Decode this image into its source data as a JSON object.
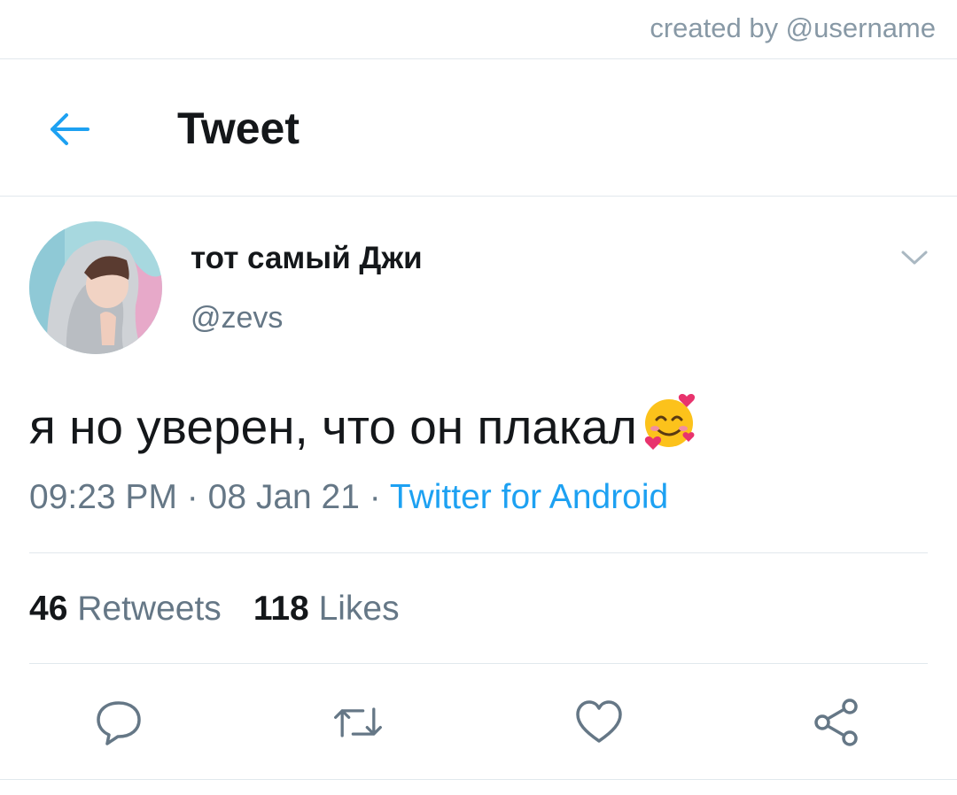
{
  "watermark": "created by @username",
  "header": {
    "title": "Tweet",
    "back_icon": "arrow-left-icon"
  },
  "tweet": {
    "display_name": "тот самый Джи",
    "handle": "@zevs",
    "text": "я но уверен, что он плакал",
    "emoji": "smiling-face-with-hearts",
    "time": "09:23 PM",
    "sep1": "·",
    "date": "08 Jan 21",
    "sep2": "·",
    "source": "Twitter for Android"
  },
  "stats": {
    "retweets_count": "46",
    "retweets_label": "Retweets",
    "likes_count": "118",
    "likes_label": "Likes"
  },
  "actions": [
    "reply-icon",
    "retweet-icon",
    "like-icon",
    "share-icon"
  ],
  "colors": {
    "accent": "#1da1f2",
    "muted": "#657786",
    "divider": "#e1e8ed"
  }
}
